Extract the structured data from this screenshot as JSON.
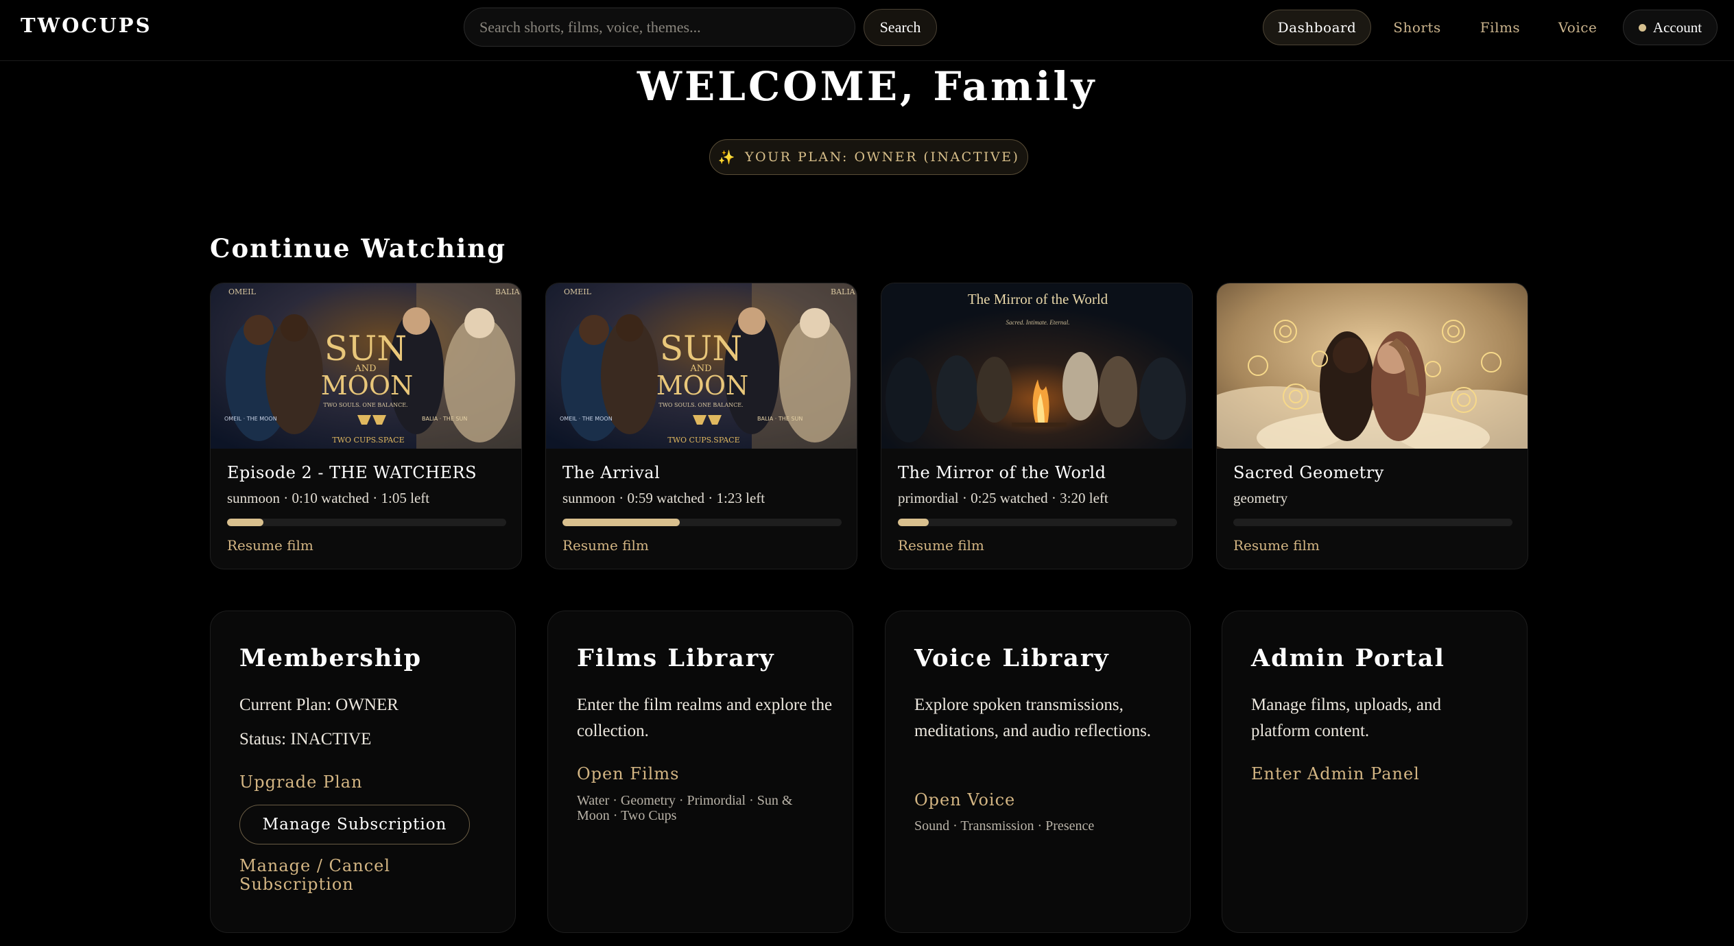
{
  "header": {
    "brand": "TWOCUPS",
    "search_placeholder": "Search shorts, films, voice, themes...",
    "search_label": "Search",
    "nav": [
      {
        "label": "Dashboard",
        "active": true
      },
      {
        "label": "Shorts",
        "active": false
      },
      {
        "label": "Films",
        "active": false
      },
      {
        "label": "Voice",
        "active": false
      }
    ],
    "account_label": "Account"
  },
  "hero": {
    "welcome": "WELCOME, Family",
    "plan_pill": "YOUR PLAN: OWNER (INACTIVE)",
    "plan_icon": "sparkles-icon"
  },
  "continue_watching": {
    "title": "Continue Watching",
    "items": [
      {
        "title": "Episode 2 - THE WATCHERS",
        "meta": "sunmoon · 0:10 watched · 1:05 left",
        "progress": 0.13,
        "action": "Resume film",
        "poster": {
          "name_left": "OMEIL",
          "name_right": "BALIA",
          "title_top": "SUN",
          "title_mid": "AND",
          "title_bottom": "MOON",
          "site": "TWO CUPS.SPACE",
          "tagline": "TWO SOULS. ONE BALANCE.",
          "legend_left": "OMEIL · THE MOON",
          "legend_right": "BALIA · THE SUN"
        }
      },
      {
        "title": "The Arrival",
        "meta": "sunmoon · 0:59 watched · 1:23 left",
        "progress": 0.42,
        "action": "Resume film",
        "poster": {
          "name_left": "OMEIL",
          "name_right": "BALIA",
          "title_top": "SUN",
          "title_mid": "AND",
          "title_bottom": "MOON",
          "site": "TWO CUPS.SPACE",
          "tagline": "TWO SOULS. ONE BALANCE.",
          "legend_left": "OMEIL · THE MOON",
          "legend_right": "BALIA · THE SUN"
        }
      },
      {
        "title": "The Mirror of the World",
        "meta": "primordial · 0:25 watched · 3:20 left",
        "progress": 0.11,
        "action": "Resume film",
        "poster": {
          "title": "The Mirror of the World",
          "subtitle": "Sacred. Intimate. Eternal."
        }
      },
      {
        "title": "Sacred Geometry",
        "meta": "geometry",
        "progress": 0,
        "action": "Resume film"
      }
    ]
  },
  "panels": {
    "membership": {
      "title": "Membership",
      "plan": "Current Plan: OWNER",
      "status": "Status: INACTIVE",
      "upgrade": "Upgrade Plan",
      "manage_button": "Manage Subscription",
      "manage_cancel": "Manage / Cancel Subscription"
    },
    "films": {
      "title": "Films Library",
      "description": "Enter the film realms and explore the collection.",
      "link": "Open Films",
      "tags": "Water · Geometry · Primordial · Sun & Moon · Two Cups"
    },
    "voice": {
      "title": "Voice Library",
      "description": "Explore spoken transmissions, meditations, and audio reflections.",
      "link": "Open Voice",
      "tags": "Sound · Transmission · Presence"
    },
    "admin": {
      "title": "Admin Portal",
      "description": "Manage films, uploads, and platform content.",
      "link": "Enter Admin Panel"
    }
  },
  "colors": {
    "accent": "#d3b583",
    "progress": "#d9c08e",
    "background": "#000000"
  }
}
